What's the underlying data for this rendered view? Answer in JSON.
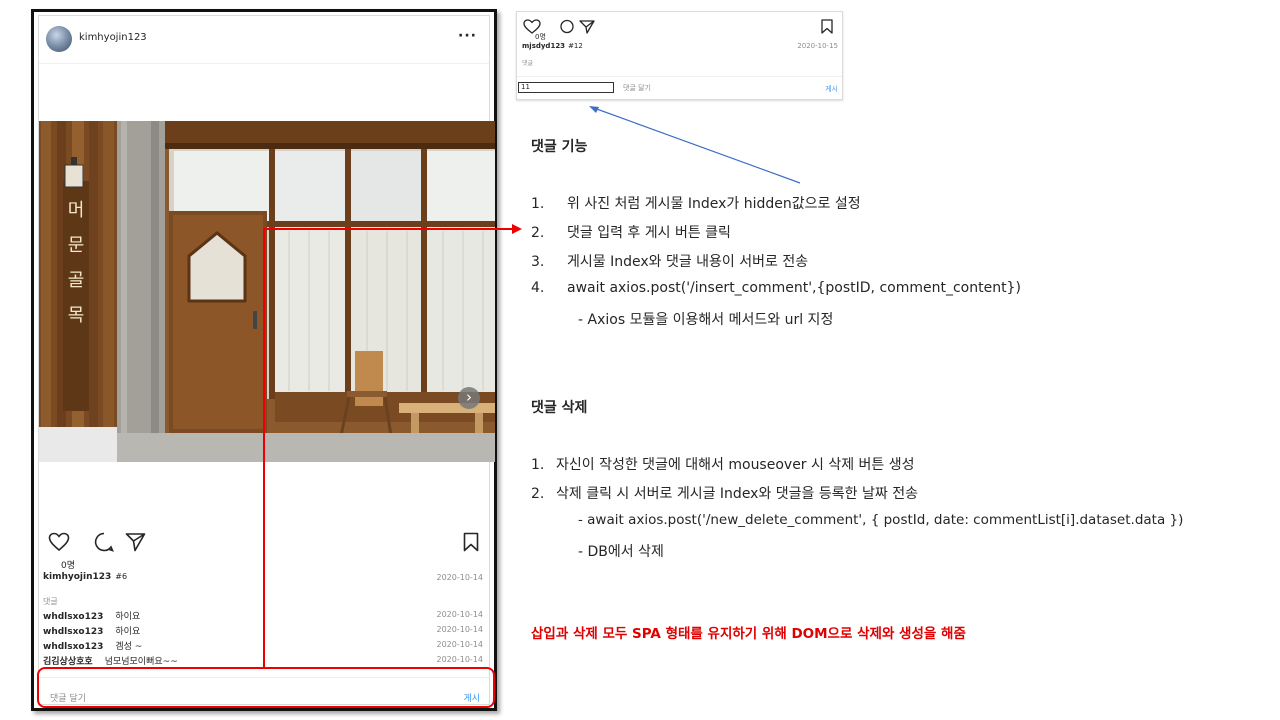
{
  "post": {
    "username": "kimhyojin123",
    "more": "···",
    "sign_text": "머문골목",
    "like_count": "0명",
    "author": "kimhyojin123",
    "post_index": "#6",
    "date": "2020-10-14",
    "comment_label": "댓글",
    "comments": [
      {
        "user": "whdlsxo123",
        "text": "하이요",
        "date": "2020-10-14"
      },
      {
        "user": "whdlsxo123",
        "text": "하이요",
        "date": "2020-10-14"
      },
      {
        "user": "whdlsxo123",
        "text": "겜성 ~",
        "date": "2020-10-14"
      },
      {
        "user": "김김상상호호",
        "text": "넘모넘모이뻐요~~",
        "date": "2020-10-14"
      }
    ],
    "input_placeholder": "댓글 달기",
    "post_button": "게시"
  },
  "mini": {
    "like_count": "0명",
    "user": "mjsdyd123",
    "post_index": "#12",
    "date": "2020-10-15",
    "comment_label": "댓글",
    "input_value": "11",
    "input_placeholder": "댓글 달기",
    "post_button": "게시"
  },
  "explain": {
    "section1_title": "댓글 기능",
    "section1_items": [
      {
        "num": "1.",
        "text": "위 사진 처럼 게시물 Index가 hidden값으로 설정"
      },
      {
        "num": "2.",
        "text": "댓글 입력 후 게시 버튼 클릭"
      },
      {
        "num": "3.",
        "text": "게시물 Index와 댓글 내용이 서버로 전송"
      },
      {
        "num": "4.",
        "text": "await axios.post('/insert_comment',{postID,  comment_content})"
      }
    ],
    "section1_sub": "-  Axios 모듈을 이용해서 메서드와 url 지정",
    "section2_title": "댓글 삭제",
    "section2_items": [
      {
        "num": "1.",
        "text": "자신이 작성한 댓글에 대해서 mouseover 시 삭제 버튼 생성"
      },
      {
        "num": "2.",
        "text": "삭제 클릭 시 서버로 게시글 Index와 댓글을 등록한 날짜 전송"
      }
    ],
    "section2_sub": [
      "-  await axios.post('/new_delete_comment',  { postId, date: commentList[i].dataset.data })",
      "-  DB에서 삭제"
    ],
    "note": "삽입과 삭제 모두 SPA 형태를 유지하기 위해 DOM으로 삭제와 생성을 해줌"
  },
  "colors": {
    "accent_blue": "#3897f0",
    "annotation_red": "#e00000"
  }
}
